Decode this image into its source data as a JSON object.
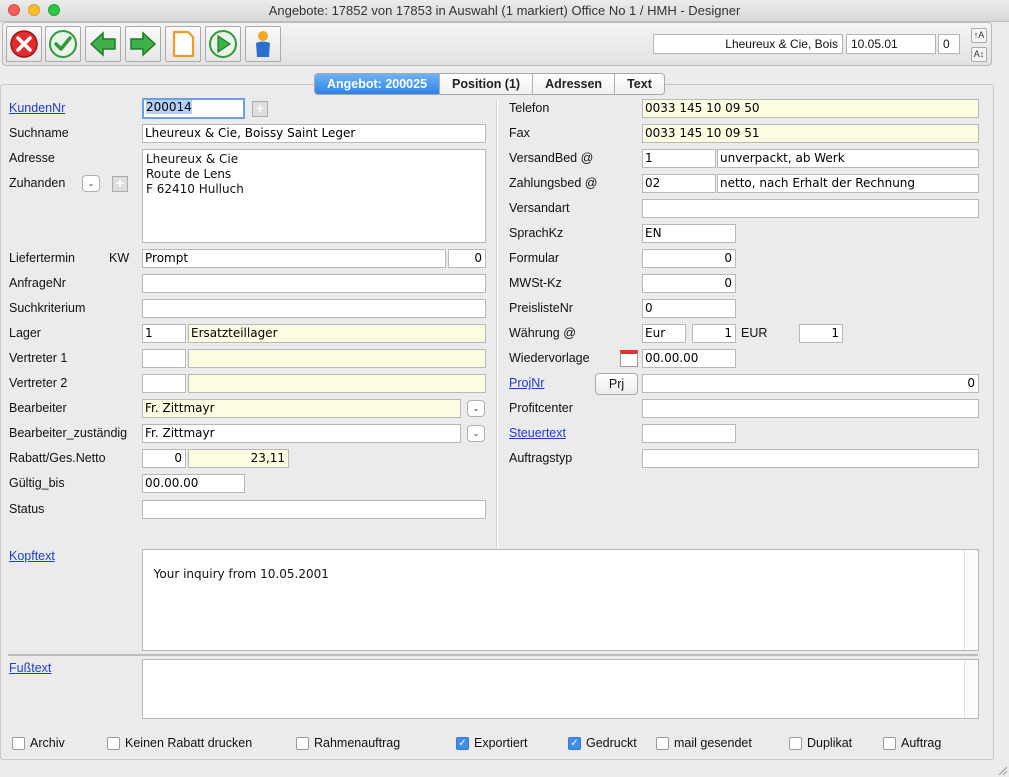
{
  "window": {
    "title": "Angebote: 17852 von 17853 in Auswahl  (1 markiert) Office No 1 /  HMH - Designer"
  },
  "toolbar": {
    "buttons": [
      "cancel",
      "ok",
      "back",
      "forward",
      "new-document",
      "play",
      "person"
    ],
    "customer_name": "Lheureux & Cie, Bois",
    "date": "10.05.01",
    "count": "0"
  },
  "tabs": [
    "Angebot: 200025",
    "Position (1)",
    "Adressen",
    "Text"
  ],
  "left": {
    "kundennr_label": "KundenNr",
    "kundennr_value": "200014",
    "suchname_label": "Suchname",
    "suchname_value": "Lheureux & Cie, Boissy Saint Leger",
    "adresse_label": "Adresse",
    "adresse_value": "Lheureux & Cie\nRoute de Lens\nF 62410 Hulluch",
    "zuhanden_label": "Zuhanden",
    "liefertermin_label": "Liefertermin",
    "kw_label": "KW",
    "liefertermin_value": "Prompt",
    "kw_value": "0",
    "anfragenr_label": "AnfrageNr",
    "anfragenr_value": "",
    "suchkriterium_label": "Suchkriterium",
    "suchkriterium_value": "",
    "lager_label": "Lager",
    "lager_nr": "1",
    "lager_name": "Ersatzteillager",
    "vertreter1_label": "Vertreter 1",
    "vertreter1_nr": "",
    "vertreter1_name": "",
    "vertreter2_label": "Vertreter 2",
    "vertreter2_nr": "",
    "vertreter2_name": "",
    "bearbeiter_label": "Bearbeiter",
    "bearbeiter_value": "Fr. Zittmayr",
    "bearbeiter_zust_label": "Bearbeiter_zuständig",
    "bearbeiter_zust_value": "Fr. Zittmayr",
    "rabatt_label": "Rabatt/Ges.Netto",
    "rabatt_value": "0",
    "netto_value": "23,11",
    "gueltig_label": "Gültig_bis",
    "gueltig_value": "00.00.00",
    "status_label": "Status",
    "status_value": ""
  },
  "right": {
    "telefon_label": "Telefon",
    "telefon_value": "0033 145 10 09 50",
    "fax_label": "Fax",
    "fax_value": "0033 145 10 09 51",
    "versandbed_label": "VersandBed @",
    "versandbed_nr": "1",
    "versandbed_text": "unverpackt, ab Werk",
    "zahlungsbed_label": "Zahlungsbed @",
    "zahlungsbed_nr": "02",
    "zahlungsbed_text": "netto, nach Erhalt  der Rechnung",
    "versandart_label": "Versandart",
    "versandart_value": "",
    "sprachkz_label": "SprachKz",
    "sprachkz_value": "EN",
    "formular_label": "Formular",
    "formular_value": "0",
    "mwst_label": "MWSt-Kz",
    "mwst_value": "0",
    "preisliste_label": "PreislisteNr",
    "preisliste_value": "0",
    "waehrung_label": "Währung @",
    "waehrung_code": "Eur",
    "waehrung_factor": "1",
    "eur_label": "EUR",
    "eur_value": "1",
    "wiedervorlage_label": "Wiedervorlage",
    "wiedervorlage_value": "00.00.00",
    "projnr_label": "ProjNr",
    "prj_button": "Prj",
    "projnr_value": "0",
    "profitcenter_label": "Profitcenter",
    "profitcenter_value": "",
    "steuertext_label": "Steuertext",
    "steuertext_value": "",
    "auftragstyp_label": "Auftragstyp",
    "auftragstyp_value": ""
  },
  "texts": {
    "kopftext_label": "Kopftext",
    "kopftext_value": "Your inquiry from 10.05.2001",
    "fusstext_label": "Fußtext",
    "fusstext_value": ""
  },
  "checkboxes": [
    {
      "label": "Archiv",
      "checked": false
    },
    {
      "label": "Keinen Rabatt drucken",
      "checked": false
    },
    {
      "label": "Rahmenauftrag",
      "checked": false
    },
    {
      "label": "Exportiert",
      "checked": true
    },
    {
      "label": "Gedruckt",
      "checked": true
    },
    {
      "label": "mail gesendet",
      "checked": false
    },
    {
      "label": "Duplikat",
      "checked": false
    },
    {
      "label": "Auftrag",
      "checked": false
    }
  ]
}
